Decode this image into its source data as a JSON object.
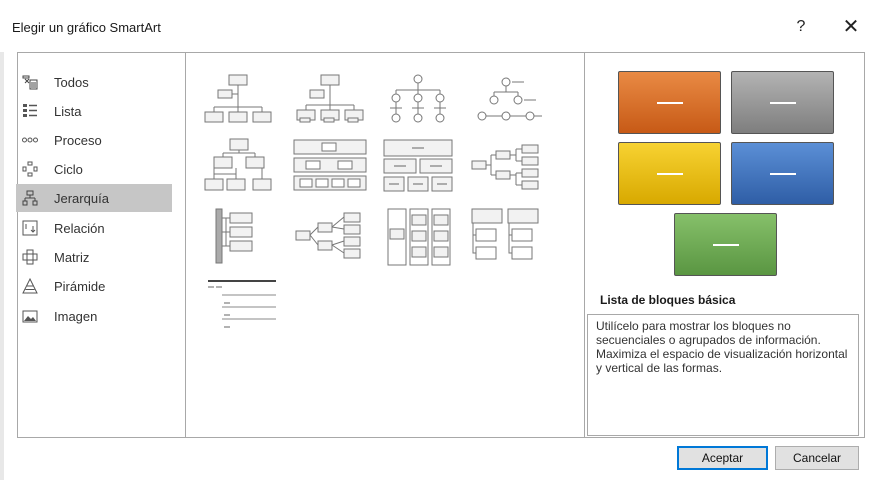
{
  "dialog": {
    "title": "Elegir un gráfico SmartArt",
    "help_label": "?",
    "close_label": "✕"
  },
  "categories": [
    {
      "label": "Todos",
      "icon": "all-icon",
      "selected": false
    },
    {
      "label": "Lista",
      "icon": "list-icon",
      "selected": false
    },
    {
      "label": "Proceso",
      "icon": "process-icon",
      "selected": false
    },
    {
      "label": "Ciclo",
      "icon": "cycle-icon",
      "selected": false
    },
    {
      "label": "Jerarquía",
      "icon": "hierarchy-icon",
      "selected": true
    },
    {
      "label": "Relación",
      "icon": "relationship-icon",
      "selected": false
    },
    {
      "label": "Matriz",
      "icon": "matrix-icon",
      "selected": false
    },
    {
      "label": "Pirámide",
      "icon": "pyramid-icon",
      "selected": false
    },
    {
      "label": "Imagen",
      "icon": "picture-icon",
      "selected": false
    }
  ],
  "preview": {
    "title": "Lista de bloques básica",
    "description": "Utilícelo para mostrar los bloques no secuenciales o agrupados de información. Maximiza el espacio de visualización horizontal y vertical de las formas.",
    "block_colors": [
      "#d9651e",
      "#8c8c8c",
      "#e8b800",
      "#3c6db5",
      "#6aa84f"
    ]
  },
  "buttons": {
    "ok": "Aceptar",
    "cancel": "Cancelar"
  },
  "colors": {
    "selected_bg": "#c6c6c6",
    "default_button_border": "#0078d7"
  }
}
